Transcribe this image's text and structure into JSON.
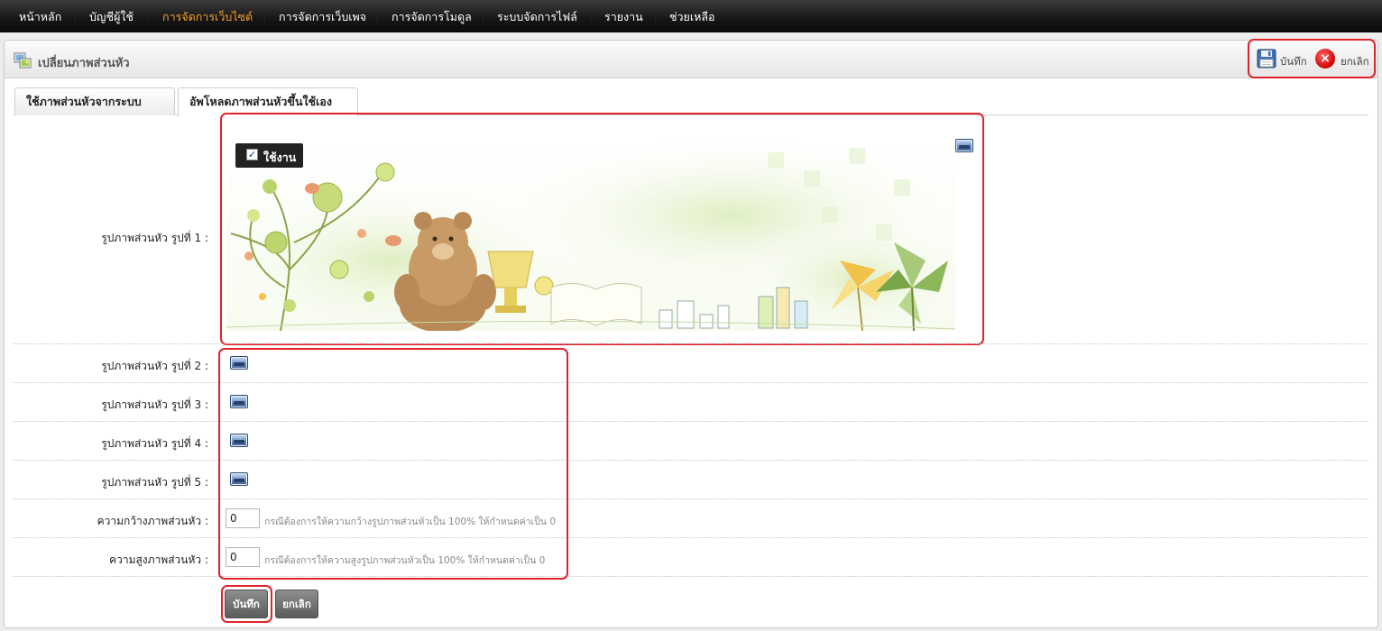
{
  "nav": {
    "items": [
      "หน้าหลัก",
      "บัญชีผู้ใช้",
      "การจัดการเว็บไซต์",
      "การจัดการเว็บเพจ",
      "การจัดการโมดูล",
      "ระบบจัดการไฟล์",
      "รายงาน",
      "ช่วยเหลือ"
    ],
    "active_index": 2
  },
  "header": {
    "title": "เปลี่ยนภาพส่วนหัว",
    "save_label": "บันทึก",
    "cancel_label": "ยกเลิก"
  },
  "tabs": [
    {
      "label": "ใช้ภาพส่วนหัวจากระบบ"
    },
    {
      "label": "อัพโหลดภาพส่วนหัวขึ้นใช้เอง",
      "active": true
    }
  ],
  "form": {
    "image_rows": [
      {
        "label": "รูปภาพส่วนหัว รูปที่ 1 :",
        "has_image": true,
        "enabled_label": "ใช้งาน",
        "enabled": true
      },
      {
        "label": "รูปภาพส่วนหัว รูปที่ 2 :",
        "has_image": false
      },
      {
        "label": "รูปภาพส่วนหัว รูปที่ 3 :",
        "has_image": false
      },
      {
        "label": "รูปภาพส่วนหัว รูปที่ 4 :",
        "has_image": false
      },
      {
        "label": "รูปภาพส่วนหัว รูปที่ 5 :",
        "has_image": false
      }
    ],
    "width": {
      "label": "ความกว้างภาพส่วนหัว :",
      "value": "0",
      "hint": "กรณีต้องการให้ความกว้างรูปภาพส่วนหัวเป็น 100% ให้กำหนดค่าเป็น 0"
    },
    "height": {
      "label": "ความสูงภาพส่วนหัว :",
      "value": "0",
      "hint": "กรณีต้องการให้ความสูงรูปภาพส่วนหัวเป็น 100% ให้กำหนดค่าเป็น 0"
    },
    "save_button": "บันทึก",
    "cancel_button": "ยกเลิก"
  },
  "colors": {
    "nav_active": "#f6a031",
    "highlight": "#e0232b"
  }
}
